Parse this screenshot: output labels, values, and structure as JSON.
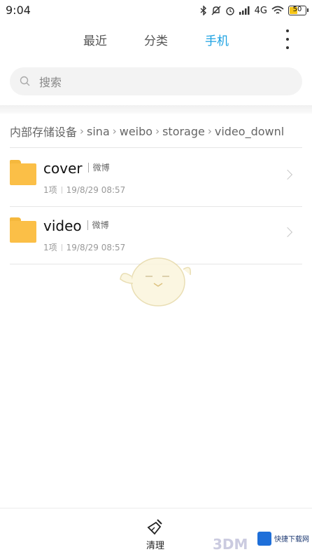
{
  "status": {
    "time": "9:04",
    "network": "4G",
    "battery": "50"
  },
  "tabs": [
    {
      "label": "最近",
      "active": false
    },
    {
      "label": "分类",
      "active": false
    },
    {
      "label": "手机",
      "active": true
    }
  ],
  "search": {
    "placeholder": "搜索",
    "value": ""
  },
  "breadcrumb": [
    "内部存储设备",
    "sina",
    "weibo",
    "storage",
    "video_downl"
  ],
  "folders": [
    {
      "name": "cover",
      "tag": "微博",
      "count": "1项",
      "date": "19/8/29 08:57"
    },
    {
      "name": "video",
      "tag": "微博",
      "count": "1项",
      "date": "19/8/29 08:57"
    }
  ],
  "bottom": {
    "clean_label": "清理"
  },
  "watermark": {
    "brand": "3DM",
    "site": "快捷下载网"
  },
  "colors": {
    "accent": "#1ba1e2",
    "folder": "#fbbf47"
  }
}
